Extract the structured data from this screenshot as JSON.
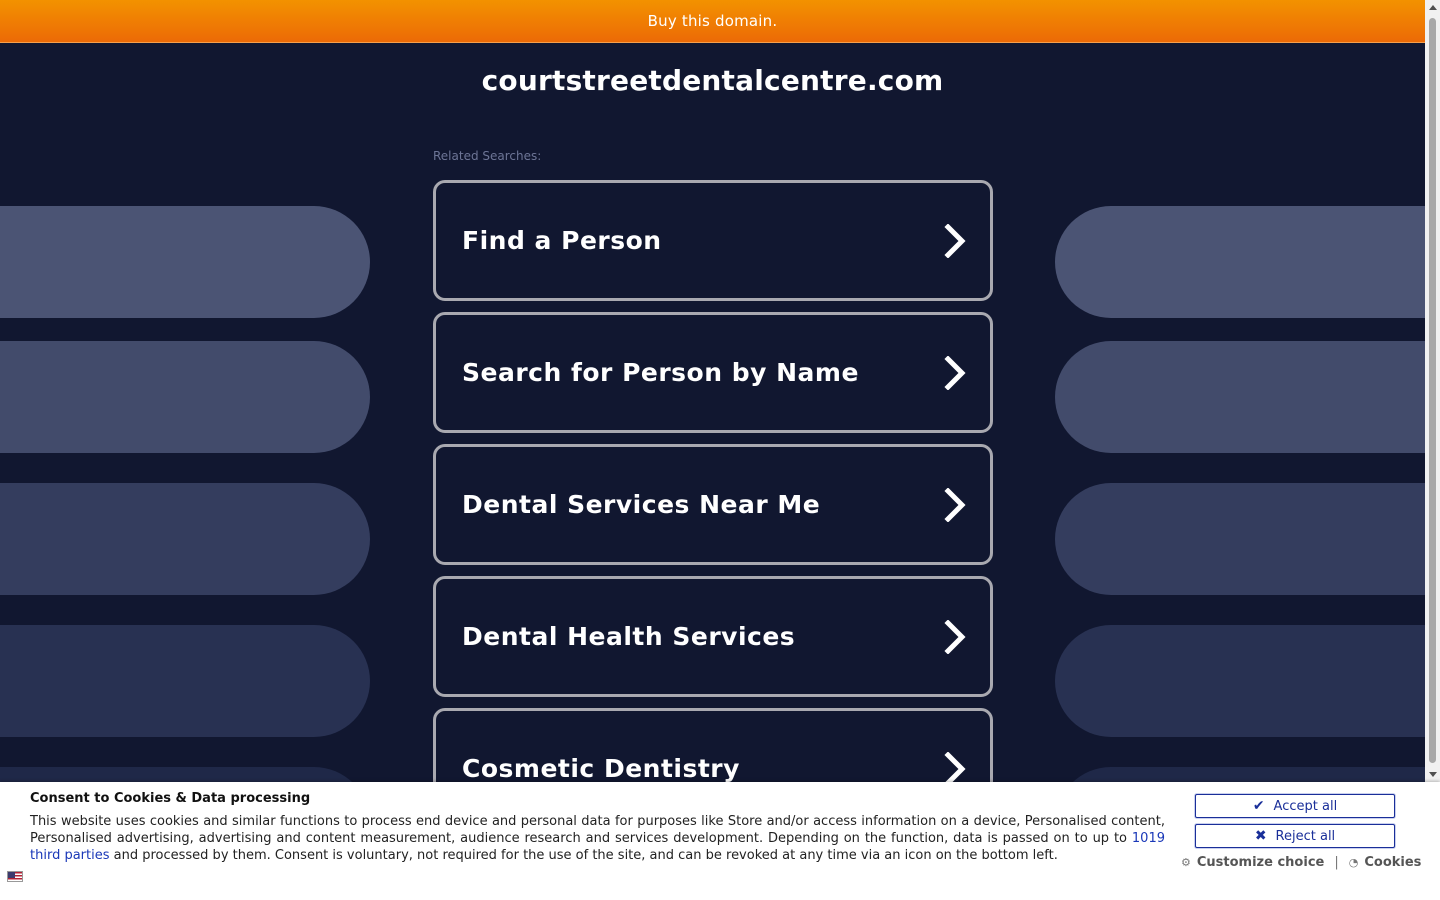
{
  "topbar": {
    "label": "Buy this domain."
  },
  "site": {
    "title": "courtstreetdentalcentre.com"
  },
  "related": {
    "heading": "Related Searches:",
    "items": [
      {
        "label": "Find a Person"
      },
      {
        "label": "Search for Person by Name"
      },
      {
        "label": "Dental Services Near Me"
      },
      {
        "label": "Dental Health Services"
      },
      {
        "label": "Cosmetic Dentistry"
      }
    ]
  },
  "consent": {
    "title": "Consent to Cookies & Data processing",
    "text_before": "This website uses cookies and similar functions to process end device and personal data for purposes like Store and/or access information on a device, Personalised content, Personalised advertising, advertising and content measurement, audience research and services development. Depending on the function, data is passed on to up to ",
    "third_parties_link": "1019 third parties",
    "text_after": " and processed by them. Consent is voluntary, not required for the use of the site, and can be revoked at any time via an icon on the bottom left.",
    "accept_label": "Accept all",
    "reject_label": "Reject all",
    "customize_label": "Customize choice",
    "separator": "|",
    "cookies_label": "Cookies"
  },
  "colors": {
    "background": "#111730",
    "topbar": "#f08000",
    "pill_light": "#4a5373",
    "pill_dark": "#1f2848",
    "consent_button": "#1a2f99"
  }
}
